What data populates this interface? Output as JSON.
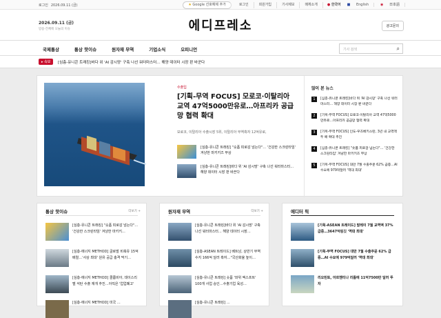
{
  "topbar": {
    "login_label": "로그인",
    "date_value": "2026.09.11 (금)",
    "google_btn": "Google 선호예제 추가",
    "links": [
      "로그인",
      "회원가입",
      "기사제보",
      "매체소개"
    ],
    "langs": [
      "한국어",
      "English",
      "日本語"
    ]
  },
  "header": {
    "date": "2026.09.11 (금)",
    "subline": "방송-전체에 오늘의 이슈",
    "logo": "에디프레소",
    "ad_button": "광고문의"
  },
  "nav": {
    "items": [
      "국제통상",
      "통상 핫이슈",
      "원자재 무역",
      "기업소식",
      "오피니언"
    ],
    "search_placeholder": "기사 검색"
  },
  "breaking": {
    "badge": "속보",
    "text": "[심층-유니콘 트래킹]바다 위 'AI 감시망' 구축 나선 워터마스터… 해양 데이터 시장 판 바꾼다"
  },
  "hero": {
    "category": "수출입",
    "title": "[기획-무역 FOCUS] 모로코·이탈리아 교역 47억5000만유로…아프리카 공급망 협력 확대",
    "summary": "모로코, 이탈리아 수출시장 5위, 이탈리아 무역흑자 12억유로,",
    "subs": [
      {
        "title": "[심층-유니콘 트래킹] \"숏폼 피로감 넘는다\"… '건강한 스크린타임' 겨냥한 마키키즈 부상"
      },
      {
        "title": "[심층-유니콘 트래킹]바다 위 'AI 감시망' 구축 나선 워터마스터… 해양 데이터 시장 판 바꾼다"
      }
    ]
  },
  "popular": {
    "heading": "많이 본 뉴스",
    "items": [
      "[심층-유니콘 트래킹]바다 위 'AI 감시망' 구축 나선 워터마스터… 해양 데이터 시장 판 바꾼다",
      "[기획-무역 FOCUS] 모로코·이탈리아 교역 47억5000만유로…아프리카 공급망 협력 확대",
      "[기획-무역 FOCUS] 인도-우즈베키스탄, 3년 내 교역액 두 배 확대 추진",
      "[심층-유니콘 트래킹] \"숏폼 피로감 넘는다\"… '건강한 스크린타임' 겨냥한 마키키즈 부상",
      "[기획-무역 FOCUS] 대만 7월 수출주문 62% 급증…AI 수요에 979억달러 '역대 최대'"
    ]
  },
  "columns": [
    {
      "heading": "통상 핫이슈",
      "more": "더보기 +",
      "items": [
        "[심층-유니콘 트래킹] \"숏폼 피로감 넘는다\"… '건강한 스크린타임' 겨냥한 마키키…",
        "[심층-에너지 METHOD] 글로벌 비축유 15억 배럴…'사상 최대' 원유 공급 충격 막기…",
        "[심층-에너지 METHOD] 콜롬비아, 데이스리벨 석탄 수출 재개 추진…아직은 '업업폐고'",
        "[심층-에너지 METHOD] 미국 …"
      ]
    },
    {
      "heading": "원자재 무역",
      "more": "더보기 +",
      "items": [
        "[심층-유니콘 트래킹]바다 위 'AI 감시망' 구축 나선 워터마스터… 해양 데이터 시장…",
        "[심층-ASEAN 트레이드] 베트남, 상반기 무역수지 166억 달러 흑자…\"국산화율 높이…",
        "[심층-유니콘 트래킹] 숏폼 '와위 엑스프트' 100개 사업 승인…수출기업 육성…",
        "[심층-유니콘 트래킹] …"
      ]
    },
    {
      "heading": "에디터 픽",
      "more": "",
      "items": [
        "[기획-ASEAN 트레이드] 말레이 7월 교역액 37% 급증…3647억링깃 '역대 최대'",
        "[기획-무역 FOCUS] 대만 7월 수출주문 62% 급증…AI 수요에 979억달러 '역대 최대'",
        "리오틴토, 아르헨티나 리튬에 11억7500만 달러 투자"
      ]
    }
  ],
  "colors": {
    "accent": "#c8102e",
    "dark": "#111111"
  }
}
